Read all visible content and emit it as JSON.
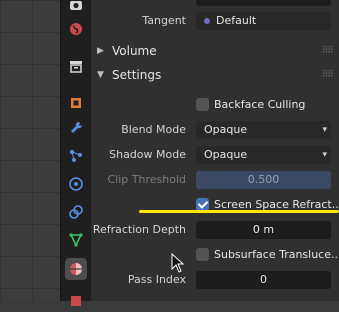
{
  "panel": {
    "tangent": {
      "label": "Tangent",
      "value": "Default"
    },
    "sections": {
      "volume": "Volume",
      "settings": "Settings"
    },
    "backface_culling": {
      "label": "Backface Culling",
      "checked": false
    },
    "blend_mode": {
      "label": "Blend Mode",
      "value": "Opaque"
    },
    "shadow_mode": {
      "label": "Shadow Mode",
      "value": "Opaque"
    },
    "clip_threshold": {
      "label": "Clip Threshold",
      "value": "0.500"
    },
    "screen_space_refraction": {
      "label": "Screen Space Refract...",
      "checked": true
    },
    "refraction_depth": {
      "label": "Refraction Depth",
      "value": "0 m"
    },
    "subsurface_translucency": {
      "label": "Subsurface Transluce...",
      "checked": false
    },
    "pass_index": {
      "label": "Pass Index",
      "value": "0"
    }
  },
  "colors": {
    "highlight_line": "#ffe600",
    "accent": "#4772b3"
  }
}
